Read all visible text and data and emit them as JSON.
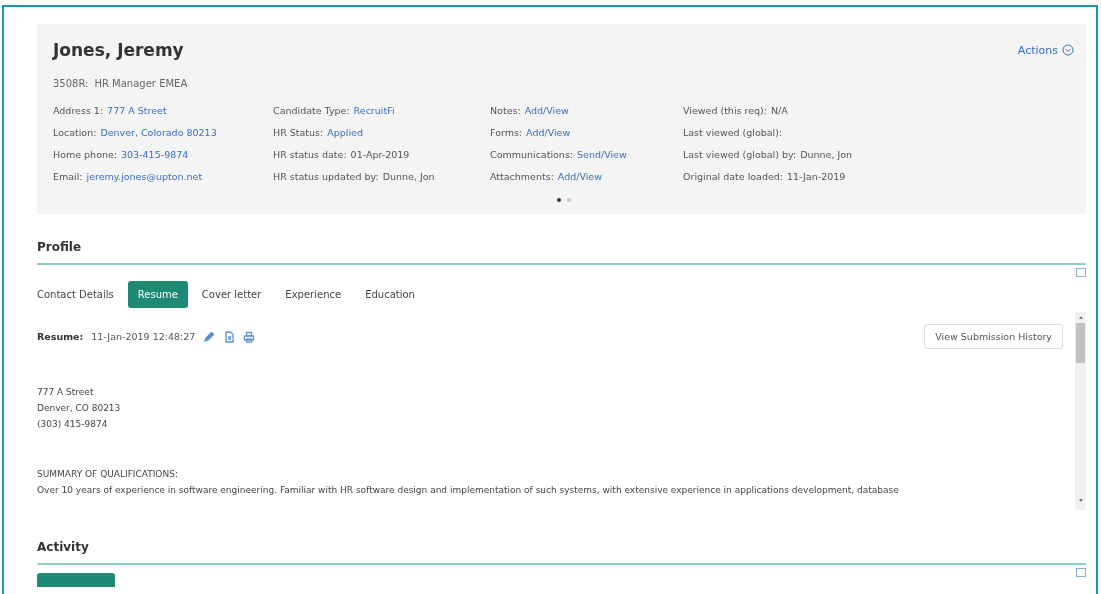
{
  "candidate": {
    "name": "Jones, Jeremy",
    "requisition_code": "3508R:",
    "requisition_title": "HR Manager EMEA",
    "actions": "Actions",
    "columns": [
      [
        {
          "label": "Address 1:",
          "value": "777 A Street",
          "kind": "link"
        },
        {
          "label": "Location:",
          "value": "Denver, Colorado 80213",
          "kind": "link"
        },
        {
          "label": "Home phone:",
          "value": "303-415-9874",
          "kind": "link"
        },
        {
          "label": "Email:",
          "value": "jeremy.jones@upton.net",
          "kind": "link"
        }
      ],
      [
        {
          "label": "Candidate Type:",
          "value": "RecruitFi",
          "kind": "link"
        },
        {
          "label": "HR Status:",
          "value": "Applied",
          "kind": "link"
        },
        {
          "label": "HR status date:",
          "value": "01-Apr-2019",
          "kind": "text"
        },
        {
          "label": "HR status updated by:",
          "value": "Dunne, Jon",
          "kind": "text"
        }
      ],
      [
        {
          "label": "Notes:",
          "value": "Add/View",
          "kind": "link"
        },
        {
          "label": "Forms:",
          "value": "Add/View",
          "kind": "link"
        },
        {
          "label": "Communications:",
          "value": "Send/View",
          "kind": "link"
        },
        {
          "label": "Attachments:",
          "value": "Add/View",
          "kind": "link"
        }
      ],
      [
        {
          "label": "Viewed (this req):",
          "value": "N/A",
          "kind": "text"
        },
        {
          "label": "Last viewed (global):"
        },
        {
          "label": "Last viewed (global) by:",
          "value": "Dunne, Jon",
          "kind": "text"
        },
        {
          "label": "Original date loaded:",
          "value": "11-Jan-2019",
          "kind": "text"
        }
      ]
    ],
    "pager": [
      {
        "selected": true
      },
      {
        "selected": false
      }
    ]
  },
  "profile": {
    "title": "Profile",
    "tabs": [
      {
        "label": "Contact Details",
        "selected": false
      },
      {
        "label": "Resume",
        "selected": true
      },
      {
        "label": "Cover letter",
        "selected": false
      },
      {
        "label": "Experience",
        "selected": false
      },
      {
        "label": "Education",
        "selected": false
      }
    ],
    "resume_label": "Resume:",
    "resume_timestamp": "11-Jan-2019 12:48:27",
    "history_button": "View Submission History",
    "resume_blocks": [
      [
        "777 A Street",
        "Denver, CO 80213",
        "(303) 415-9874"
      ],
      [
        "SUMMARY OF QUALIFICATIONS:",
        "Over 10 years of experience in software engineering. Familiar with HR software design and implementation of such systems, with extensive experience in applications development, database"
      ]
    ]
  },
  "activity": {
    "title": "Activity"
  }
}
